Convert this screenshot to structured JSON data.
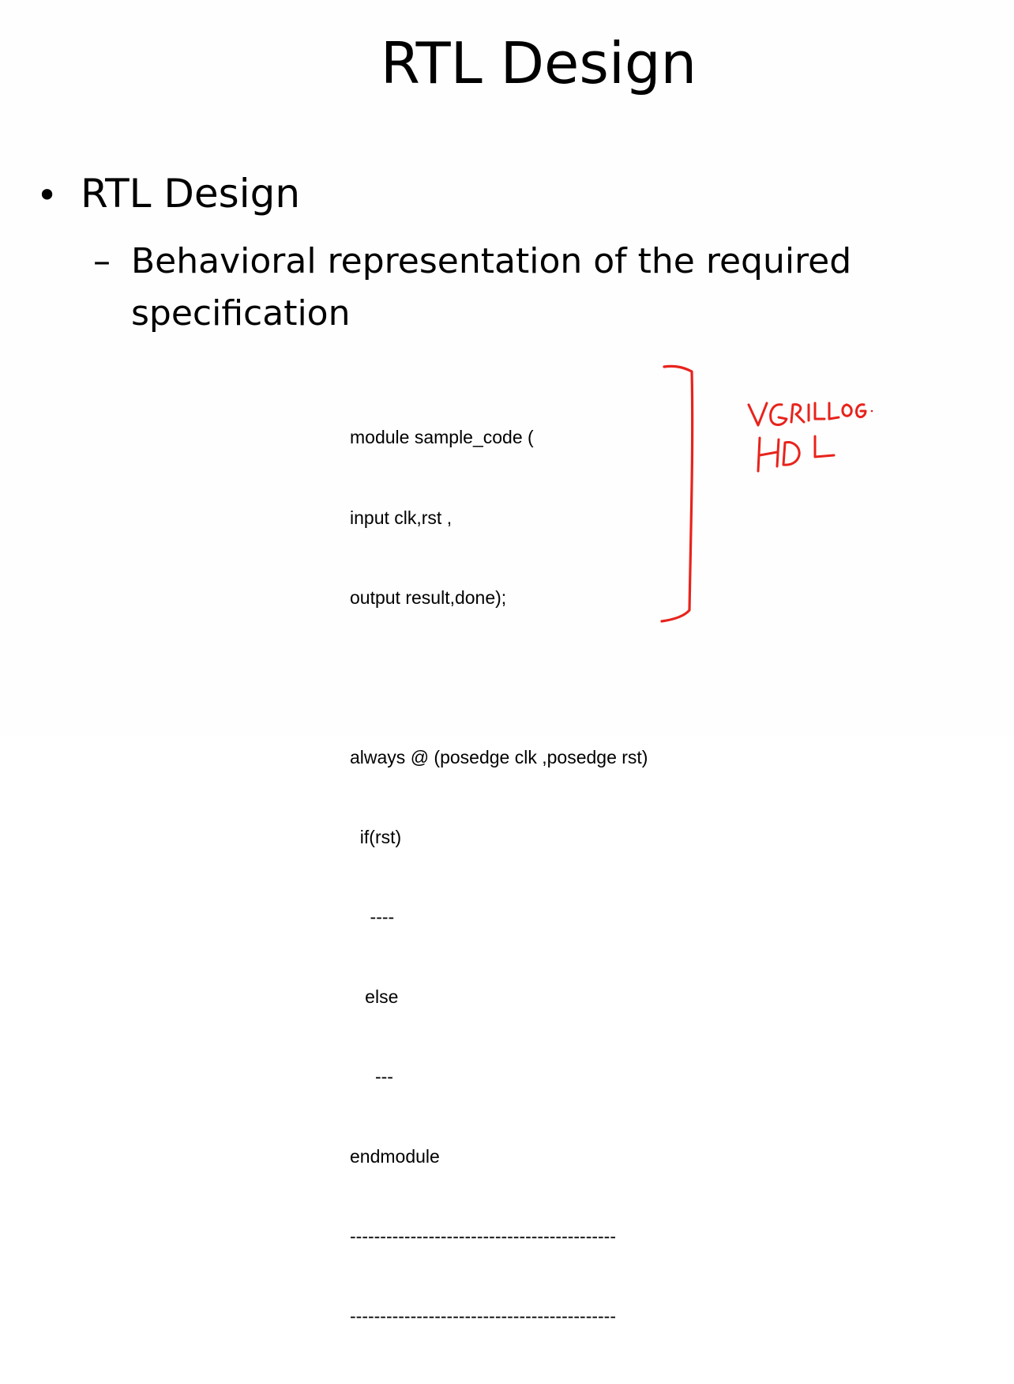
{
  "slide": {
    "title": "RTL Design",
    "bullet": {
      "symbol": "•",
      "text": "RTL Design"
    },
    "sub_bullet": {
      "symbol": "–",
      "text": "Behavioral representation of the required specification"
    },
    "code_lines": [
      "module sample_code (",
      "input clk,rst ,",
      "output result,done);",
      "",
      "always @ (posedge clk ,posedge rst)",
      "  if(rst)",
      "    ----",
      "   else",
      "     ---",
      "endmodule",
      "--------------------------------------------",
      "--------------------------------------------"
    ],
    "handwritten_note": {
      "line1": "VERILOG",
      "line2": "HDL",
      "color": "#e8231c"
    }
  }
}
